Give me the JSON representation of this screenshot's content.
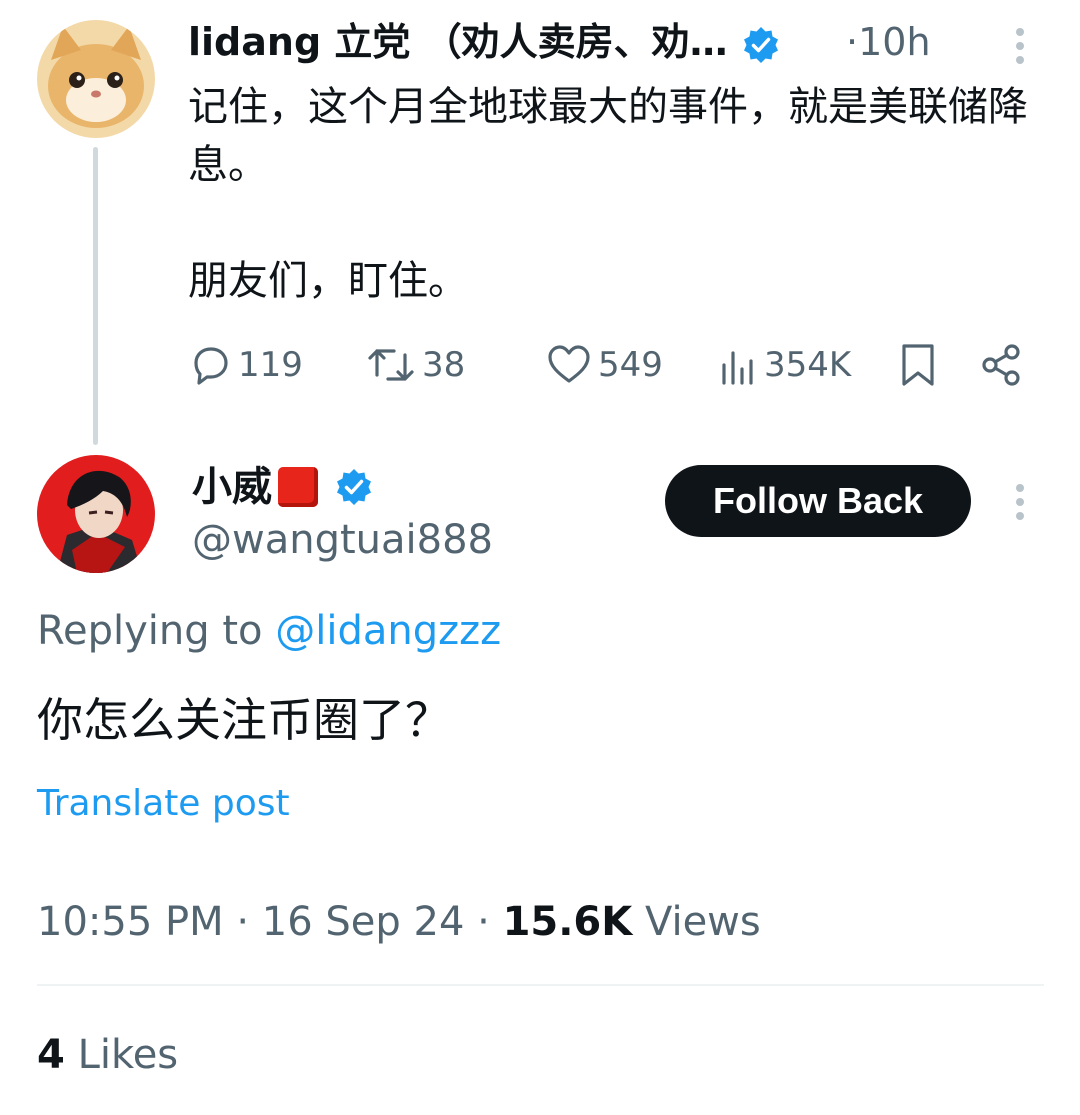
{
  "original_post": {
    "author_name": "lidang 立党 （劝人卖房、劝…",
    "separator": "·",
    "time": "10h",
    "text": "记住，这个月全地球最大的事件，就是美联储降息。\n\n朋友们，盯住。",
    "stats": {
      "replies": "119",
      "reposts": "38",
      "likes": "549",
      "views": "354K"
    }
  },
  "reply_post": {
    "author_name": "小威",
    "handle": "@wangtuai888",
    "follow_button": "Follow Back",
    "replying_label": "Replying to",
    "replying_handle": "@lidangzzz",
    "text": "你怎么关注币圈了？",
    "translate": "Translate post",
    "time": "10:55 PM",
    "date": "16 Sep 24",
    "sep": "·",
    "views_count": "15.6K",
    "views_label": "Views",
    "likes_count": "4",
    "likes_label": "Likes"
  },
  "colors": {
    "accent": "#1d9bf0",
    "text_primary": "#0f1419",
    "text_secondary": "#536471",
    "thread_line": "#cfd9de"
  },
  "icons": {
    "reply": "reply-icon",
    "repost": "repost-icon",
    "like": "heart-icon",
    "views": "views-icon",
    "bookmark": "bookmark-icon",
    "share": "share-icon",
    "verified": "verified-badge-icon",
    "more": "more-vertical-icon"
  }
}
